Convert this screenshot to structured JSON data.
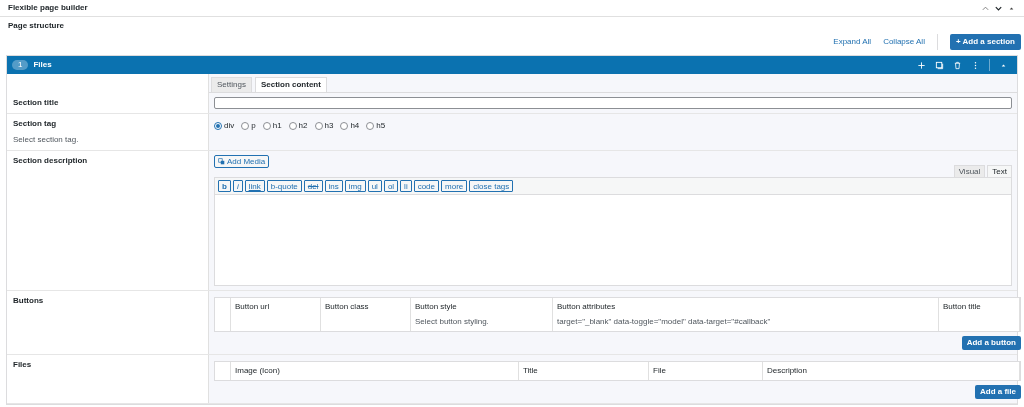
{
  "window": {
    "title": "Flexible page builder"
  },
  "page_structure": {
    "label": "Page structure",
    "links": [
      "Expand All",
      "Collapse All"
    ],
    "add_button": "+ Add a section"
  },
  "section": {
    "number": "1",
    "title": "Files",
    "tabs": [
      {
        "label": "Settings",
        "selected": false
      },
      {
        "label": "Section content",
        "selected": true
      }
    ],
    "fields": [
      {
        "kind": "text",
        "label": "Section title"
      },
      {
        "kind": "radio",
        "label": "Section tag",
        "hint": "Select section tag.",
        "options": [
          {
            "label": "div",
            "selected": true
          },
          {
            "label": "p",
            "selected": false
          },
          {
            "label": "h1",
            "selected": false
          },
          {
            "label": "h2",
            "selected": false
          },
          {
            "label": "h3",
            "selected": false
          },
          {
            "label": "h4",
            "selected": false
          },
          {
            "label": "h5",
            "selected": false
          }
        ]
      },
      {
        "kind": "editor",
        "label": "Section description",
        "media_button": "Add Media",
        "modes": [
          {
            "label": "Visual",
            "selected": false
          },
          {
            "label": "Text",
            "selected": true
          }
        ],
        "quicktags": [
          "b",
          "i",
          "link",
          "b-quote",
          "del",
          "ins",
          "img",
          "ul",
          "ol",
          "li",
          "code",
          "more",
          "close tags"
        ]
      },
      {
        "kind": "repeater",
        "label": "Buttons",
        "columns": [
          {
            "title": "Button url"
          },
          {
            "title": "Button class"
          },
          {
            "title": "Button style",
            "hint": "Select button styling."
          },
          {
            "title": "Button attributes",
            "hint": "target=\"_blank\" data-toggle=\"model\" data-target=\"#callback\""
          },
          {
            "title": "Button title"
          }
        ],
        "add_button": "Add a button"
      },
      {
        "kind": "repeater",
        "label": "Files",
        "columns": [
          {
            "title": "Image (Icon)"
          },
          {
            "title": "Title"
          },
          {
            "title": "File"
          },
          {
            "title": "Description"
          }
        ],
        "add_button": "Add a file"
      }
    ]
  }
}
